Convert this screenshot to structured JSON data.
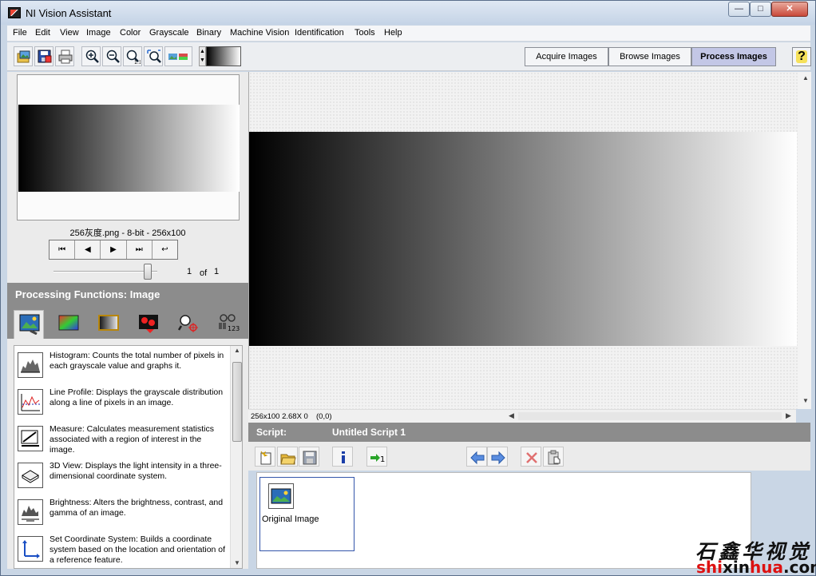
{
  "window": {
    "title": "NI Vision Assistant",
    "min": "—",
    "max": "□",
    "close": "✕"
  },
  "menu": [
    "File",
    "Edit",
    "View",
    "Image",
    "Color",
    "Grayscale",
    "Binary",
    "Machine Vision",
    "Identification",
    "Tools",
    "Help"
  ],
  "toolbar": {
    "zoom_ratio": "1:1",
    "icons": [
      "open-image-icon",
      "save-image-icon",
      "print-icon",
      "zoom-in-icon",
      "zoom-out-icon",
      "zoom-1to1-icon",
      "zoom-fit-icon",
      "image-palette-icon"
    ]
  },
  "mode_tabs": [
    "Acquire Images",
    "Browse Images",
    "Process Images"
  ],
  "active_mode": "Process Images",
  "help": "?",
  "browser": {
    "caption": "256灰度.png - 8-bit - 256x100",
    "nav": [
      "⏮",
      "◀",
      "▶",
      "⏭",
      "↩"
    ],
    "page_current": "1",
    "page_of": "of",
    "page_total": "1"
  },
  "processing": {
    "header": "Processing Functions: Image",
    "tabs": [
      "image-functions-icon",
      "color-functions-icon",
      "grayscale-functions-icon",
      "binary-functions-icon",
      "machine-vision-icon",
      "identification-icon"
    ],
    "items": [
      {
        "name": "Histogram",
        "text": "Histogram:  Counts the total number of pixels in each grayscale value and graphs it."
      },
      {
        "name": "Line Profile",
        "text": "Line Profile:  Displays the grayscale distribution along a line of pixels in an image."
      },
      {
        "name": "Measure",
        "text": "Measure:  Calculates measurement statistics associated with a region of interest in the image."
      },
      {
        "name": "3D View",
        "text": "3D View:  Displays the light intensity in a three-dimensional coordinate system."
      },
      {
        "name": "Brightness",
        "text": "Brightness:  Alters the brightness, contrast, and gamma of an image."
      },
      {
        "name": "Set Coordinate System",
        "text": "Set Coordinate System:  Builds a coordinate system based on the location and orientation of a reference feature."
      }
    ]
  },
  "viewer": {
    "status": "256x100 2.68X 0",
    "coords": "(0,0)"
  },
  "script": {
    "label": "Script:",
    "name": "Untitled Script 1",
    "steps": [
      {
        "label": "Original Image"
      }
    ]
  },
  "watermark": {
    "brush": "石鑫华视觉",
    "domain_red": "shi",
    "domain_mid": "xin",
    "domain_red2": "hua",
    "domain_tail": ".com"
  }
}
